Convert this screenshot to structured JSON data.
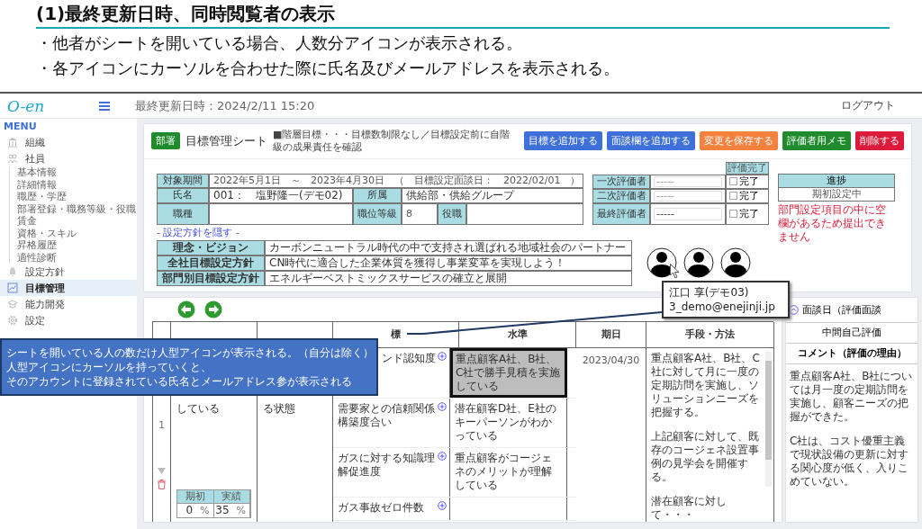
{
  "slide": {
    "title": "(1)最終更新日時、同時閲覧者の表示",
    "bullets": [
      "・他者がシートを開いている場合、人数分アイコンが表示される。",
      "・各アイコンにカーソルを合わせた際に氏名及びメールアドレスを表示される。"
    ]
  },
  "app": {
    "logo": "O-en",
    "last_updated": "最終更新日時：2024/2/11 15:20",
    "logout": "ログアウト"
  },
  "sidebar": {
    "heading": "MENU",
    "items": [
      {
        "label": "組織",
        "selected": false
      },
      {
        "label": "社員",
        "selected": false,
        "children": [
          {
            "label": "基本情報"
          },
          {
            "label": "詳細情報"
          },
          {
            "label": "職歴・学歴"
          },
          {
            "label": "部署登録・職務等級・役職"
          },
          {
            "label": "賃金"
          },
          {
            "label": "資格・スキル"
          },
          {
            "label": "昇格履歴"
          },
          {
            "label": "適性診断"
          }
        ]
      },
      {
        "label": "設定方針",
        "selected": false
      },
      {
        "label": "目標管理",
        "selected": true
      },
      {
        "label": "能力開発",
        "selected": false
      },
      {
        "label": "設定",
        "selected": false
      }
    ]
  },
  "sheet": {
    "badge": "部署",
    "title": "目標管理シート",
    "note": "■階層目標・・・目標数制限なし／目標設定前に自階級の成果責任を確認",
    "buttons": [
      {
        "label": "目標を追加する",
        "color": "#3f6fd8"
      },
      {
        "label": "面談欄を追加する",
        "color": "#3f6fd8"
      },
      {
        "label": "変更を保存する",
        "color": "#f5813f"
      },
      {
        "label": "評価者用メモ",
        "color": "#1f8b2c"
      },
      {
        "label": "削除する",
        "color": "#dc1a3c"
      }
    ]
  },
  "info": {
    "period_label": "対象期間",
    "period": "2022年5月1日　～　2023年4月30日　（　目標設定面談日：　2022/02/01　）",
    "name_label": "氏名",
    "name": "001：　塩野隆一(デモ02)",
    "dept_label": "所属",
    "dept": "供給部・供給グループ",
    "job_label": "職種",
    "grade_label": "職位等級",
    "grade": "8",
    "position_label": "役職"
  },
  "evaluators": {
    "done_header": "評価完了",
    "rows": [
      {
        "role": "一次評価者",
        "placeholder": "-----",
        "done_label": "完了",
        "checked": false
      },
      {
        "role": "二次評価者",
        "placeholder": "-----",
        "done_label": "完了",
        "checked": false
      },
      {
        "role": "最終評価者",
        "value": "-----",
        "done_label": "完了",
        "checked": false
      }
    ]
  },
  "progress": {
    "label": "進捗",
    "value": "期初設定中",
    "warning": "部門設定項目の中に空欄があるため提出できません"
  },
  "toggle_link": "- 設定方針を隠す -",
  "policies": [
    {
      "label": "理念・ビジョン",
      "value": "カーボンニュートラル時代の中で支持され選ばれる地域社会のパートナー"
    },
    {
      "label": "全社目標設定方針",
      "value": "CN時代に適合した企業体質を獲得し事業変革を実現しよう！"
    },
    {
      "label": "部門別目標設定方針",
      "value": "エネルギーベストミックスサービスの確立と展開"
    }
  ],
  "viewers": [
    {
      "hovered": true
    },
    {
      "hovered": false
    },
    {
      "hovered": false
    }
  ],
  "tooltip": {
    "name": "江口 享(デモ03)",
    "email": "3_demo@enejinji.jp"
  },
  "callout": {
    "lines": [
      "シートを開いている人の数だけ人型アイコンが表示される。（自分は除く）",
      "人型アイコンにカーソルを持っていくと、",
      "そのアカウントに登録されている氏名とメールアドレス参が表示される"
    ]
  },
  "goals": {
    "columns": {
      "indicator": "標",
      "level": "水準",
      "due": "期日",
      "method": "手段・方法"
    },
    "row_number": "1",
    "objective": "している",
    "state": "る状態",
    "baseline": {
      "label": "期初",
      "value": "0",
      "unit": "%"
    },
    "actual": {
      "label": "実績",
      "value": "35",
      "unit": "%"
    },
    "indicators": [
      {
        "text": "ンド認知度",
        "level": "重点顧客A社、B社、C社で勝手見積を実施している",
        "selected": true
      },
      {
        "text": "需要家との信頼関係構築度合い",
        "level": "潜在顧客D社、E社のキーパーソンがわかっている",
        "selected": false
      },
      {
        "text": "ガスに対する知識理解促進度",
        "level": "重点顧客がコージェネのメリットが理解している",
        "selected": false
      },
      {
        "text": "ガス事故ゼロ件数",
        "selected": false
      }
    ],
    "due": "2023/04/30",
    "method": [
      "重点顧客A社、B社、C社に対して月に一度の定期訪問を実施し、ソリューションニーズを把握する。",
      "上記顧客に対して、既存のコージェネ設置事例の見学会を開催する。",
      "潜在顧客に対して・・・"
    ]
  },
  "review": {
    "title": "面談日（評価面談",
    "subtitle": "中間自己評価",
    "comment_label": "コメント（評価の理由）",
    "comment": [
      "重点顧客A社、B社については月一度の定期訪問を実施し、顧客ニーズの把握ができた。",
      "C社は、コスト優重主義で現状設備の更新に対する関心度が低く、入りこめていない。"
    ]
  }
}
